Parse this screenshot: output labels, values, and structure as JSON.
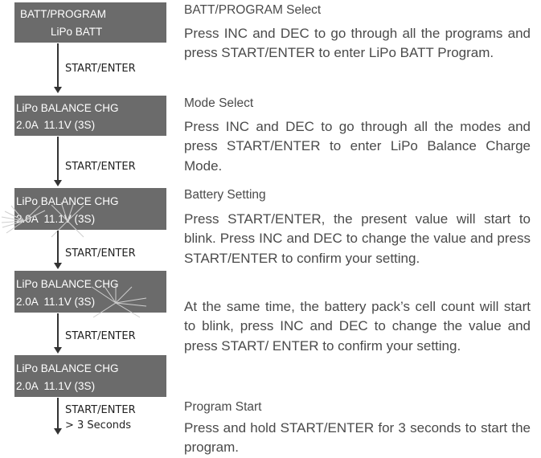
{
  "flow": {
    "screens": [
      {
        "line1": "BATT/PROGRAM",
        "line2": "LiPo BATT"
      },
      {
        "line1": "LiPo BALANCE CHG",
        "line2": "2.0A  11.1V (3S)"
      },
      {
        "line1": "LiPo BALANCE CHG",
        "line2": "2.0A  11.1V (3S)"
      },
      {
        "line1": "LiPo BALANCE CHG",
        "line2": "2.0A  11.1V (3S)"
      },
      {
        "line1": "LiPo BALANCE CHG",
        "line2": "2.0A  11.1V (3S)"
      }
    ],
    "arrows": [
      {
        "label": "START/ENTER"
      },
      {
        "label": "START/ENTER"
      },
      {
        "label": "START/ENTER"
      },
      {
        "label": "START/ENTER"
      },
      {
        "label": "START/ENTER",
        "sublabel": "> 3 Seconds"
      }
    ]
  },
  "sections": [
    {
      "title": "BATT/PROGRAM Select",
      "body": "Press INC and DEC to go through all the programs and press START/ENTER to enter LiPo BATT Program."
    },
    {
      "title": "Mode Select",
      "body": "Press INC and DEC to go through all the modes and press START/ENTER to enter LiPo Balance Charge Mode."
    },
    {
      "title": "Battery Setting",
      "body": "Press START/ENTER, the present value will start to blink. Press INC and DEC to change the value and press START/ENTER to confirm your setting.",
      "body2": "At the same time, the battery pack’s cell count will start to blink, press INC and DEC to change the value and press START/ ENTER to confirm your setting."
    },
    {
      "title": "Program Start",
      "body": "Press and hold START/ENTER for 3 seconds to start the program."
    }
  ]
}
